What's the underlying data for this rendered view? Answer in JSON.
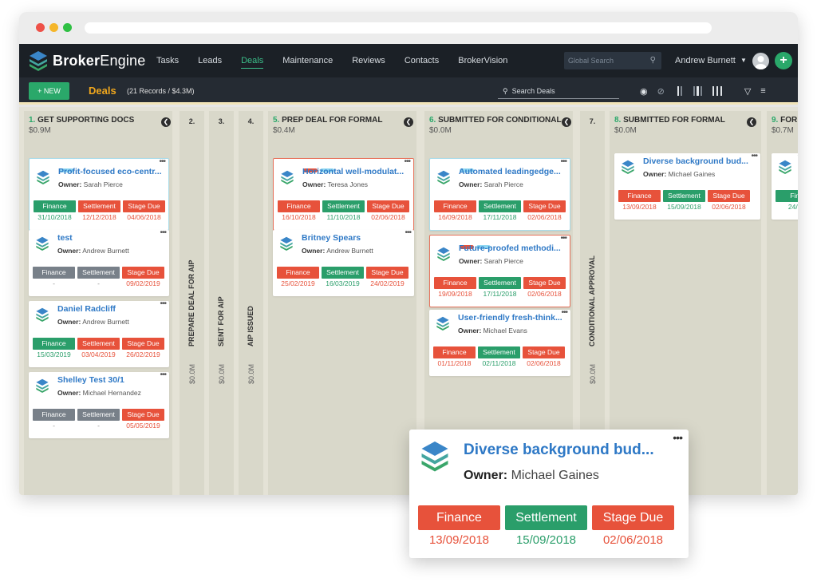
{
  "brand": {
    "name_bold": "Broker",
    "name_light": "Engine"
  },
  "nav": {
    "items": [
      "Tasks",
      "Leads",
      "Deals",
      "Maintenance",
      "Reviews",
      "Contacts",
      "BrokerVision"
    ],
    "active": "Deals"
  },
  "global_search": {
    "placeholder": "Global Search"
  },
  "user": {
    "name": "Andrew Burnett"
  },
  "toolbar": {
    "new_label": "+ NEW",
    "title": "Deals",
    "record_count": "(21 Records / $4.3M)",
    "search_placeholder": "Search Deals"
  },
  "columns": [
    {
      "num": "1.",
      "title": "GET SUPPORTING DOCS",
      "amount": "$0.9M",
      "collapsed": false
    },
    {
      "num": "2.",
      "title": "PREPARE DEAL FOR AIP",
      "amount": "$0.0M",
      "collapsed": true
    },
    {
      "num": "3.",
      "title": "SENT FOR AIP",
      "amount": "$0.0M",
      "collapsed": true
    },
    {
      "num": "4.",
      "title": "AIP ISSUED",
      "amount": "$0.0M",
      "collapsed": true
    },
    {
      "num": "5.",
      "title": "PREP DEAL FOR FORMAL",
      "amount": "$0.4M",
      "collapsed": false
    },
    {
      "num": "6.",
      "title": "SUBMITTED FOR CONDITIONAL",
      "amount": "$0.0M",
      "collapsed": false
    },
    {
      "num": "7.",
      "title": "CONDITIONAL APPROVAL",
      "amount": "$0.0M",
      "collapsed": true
    },
    {
      "num": "8.",
      "title": "SUBMITTED FOR FORMAL",
      "amount": "$0.0M",
      "collapsed": false
    },
    {
      "num": "9.",
      "title": "FOR",
      "amount": "$0.7M",
      "collapsed": false
    }
  ],
  "owner_label": "Owner:",
  "pill_labels": [
    "Finance",
    "Settlement",
    "Stage Due"
  ],
  "colors": {
    "red": "#e7523b",
    "green": "#2a9e6a",
    "gray": "#788089",
    "blue_title": "#2f79c6",
    "accent_green": "#2aa86a",
    "deals_orange": "#f0a71d"
  },
  "cards": [
    {
      "col": 0,
      "title": "Profit-focused eco-centr...",
      "owner": "Sarah Pierce",
      "tags": [
        "#8fd8f2"
      ],
      "border": "cyan",
      "status": [
        "green",
        "red",
        "red"
      ],
      "dates": [
        "31/10/2018",
        "12/12/2018",
        "04/06/2018"
      ]
    },
    {
      "col": 0,
      "title": "test",
      "owner": "Andrew Burnett",
      "tags": [],
      "border": "none",
      "status": [
        "gray",
        "gray",
        "red"
      ],
      "dates": [
        "-",
        "-",
        "09/02/2019"
      ]
    },
    {
      "col": 0,
      "title": "Daniel Radcliff",
      "owner": "Andrew Burnett",
      "tags": [],
      "border": "none",
      "status": [
        "green",
        "red",
        "red"
      ],
      "dates": [
        "15/03/2019",
        "03/04/2019",
        "26/02/2019"
      ]
    },
    {
      "col": 0,
      "title": "Shelley Test 30/1",
      "owner": "Michael Hernandez",
      "tags": [],
      "border": "none",
      "status": [
        "gray",
        "gray",
        "red"
      ],
      "dates": [
        "-",
        "-",
        "05/05/2019"
      ]
    },
    {
      "col": 4,
      "title": "Horizontal well-modulat...",
      "owner": "Teresa Jones",
      "tags": [
        "#e7523b",
        "#8fd8f2"
      ],
      "border": "red",
      "status": [
        "red",
        "green",
        "red"
      ],
      "dates": [
        "16/10/2018",
        "11/10/2018",
        "02/06/2018"
      ]
    },
    {
      "col": 4,
      "title": "Britney Spears",
      "owner": "Andrew Burnett",
      "tags": [],
      "border": "none",
      "status": [
        "red",
        "green",
        "red"
      ],
      "dates": [
        "25/02/2019",
        "16/03/2019",
        "24/02/2019"
      ]
    },
    {
      "col": 5,
      "title": "Automated leadingedge...",
      "owner": "Sarah Pierce",
      "tags": [
        "#8fd8f2"
      ],
      "border": "cyan",
      "status": [
        "red",
        "green",
        "red"
      ],
      "dates": [
        "16/09/2018",
        "17/11/2018",
        "02/06/2018"
      ]
    },
    {
      "col": 5,
      "title": "Future-proofed methodi...",
      "owner": "Sarah Pierce",
      "tags": [
        "#e7523b",
        "#8fd8f2"
      ],
      "border": "red",
      "status": [
        "red",
        "green",
        "red"
      ],
      "dates": [
        "19/09/2018",
        "17/11/2018",
        "02/06/2018"
      ]
    },
    {
      "col": 5,
      "title": "User-friendly fresh-think...",
      "owner": "Michael Evans",
      "tags": [],
      "border": "none",
      "status": [
        "red",
        "green",
        "red"
      ],
      "dates": [
        "01/11/2018",
        "02/11/2018",
        "02/06/2018"
      ]
    },
    {
      "col": 7,
      "title": "Diverse background bud...",
      "owner": "Michael Gaines",
      "tags": [],
      "border": "none",
      "status": [
        "red",
        "green",
        "red"
      ],
      "dates": [
        "13/09/2018",
        "15/09/2018",
        "02/06/2018"
      ]
    },
    {
      "col": 8,
      "title": "",
      "owner": "",
      "tags": [],
      "border": "none",
      "status": [
        "green"
      ],
      "dates": [
        "24/02"
      ],
      "pill_labels_override": [
        "Fina"
      ]
    }
  ],
  "zoom_card": {
    "title": "Diverse background bud...",
    "owner": "Michael Gaines",
    "status": [
      "red",
      "green",
      "red"
    ],
    "dates": [
      "13/09/2018",
      "15/09/2018",
      "02/06/2018"
    ]
  }
}
